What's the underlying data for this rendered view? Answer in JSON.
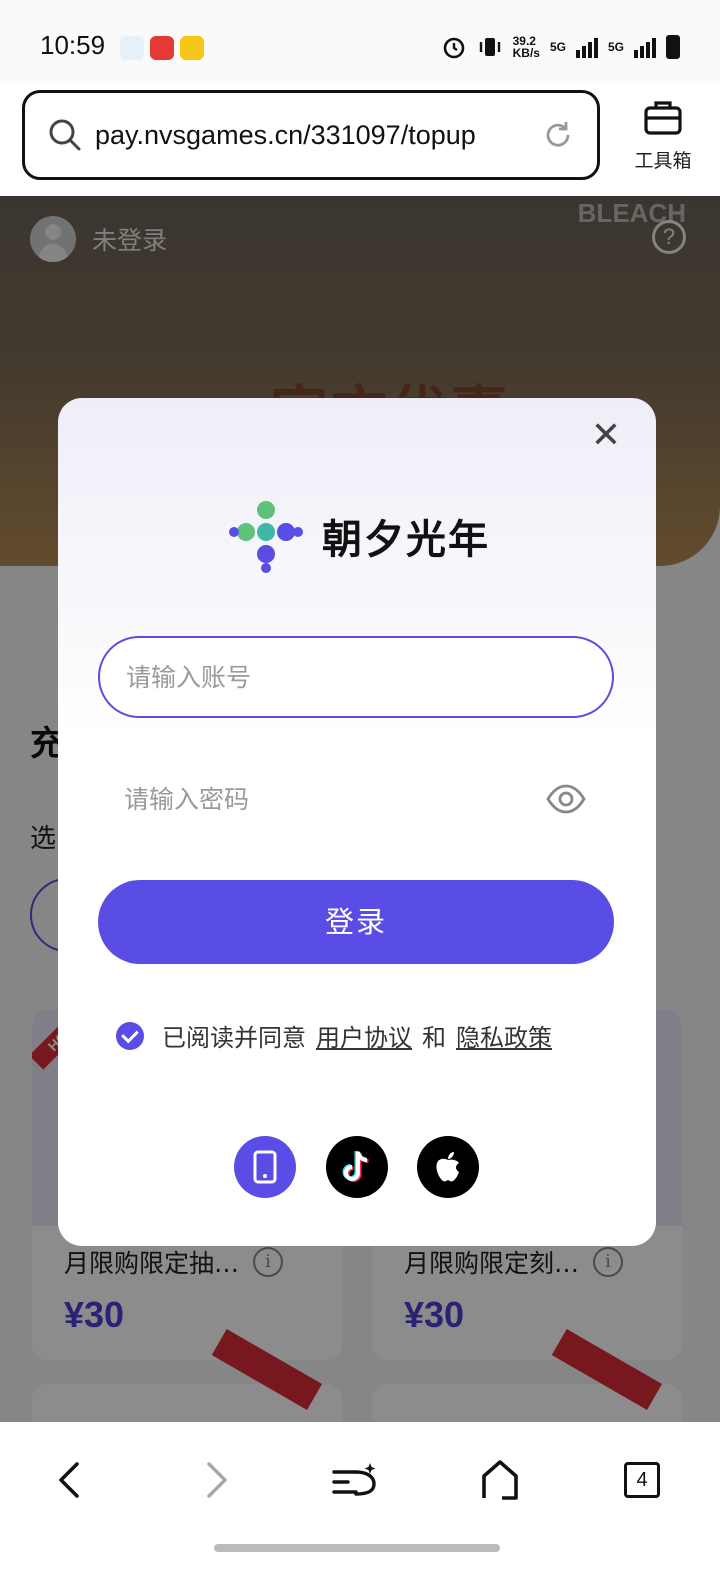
{
  "status_bar": {
    "time": "10:59",
    "network_speed_value": "39.2",
    "network_speed_unit": "KB/s",
    "sim1_label": "5G",
    "sim2_label": "5G"
  },
  "browser": {
    "url": "pay.nvsgames.cn/331097/topup",
    "toolbox_label": "工具箱",
    "tab_count": "4"
  },
  "page": {
    "user_status": "未登录",
    "help_symbol": "?",
    "brand_logo": "BLEACH",
    "banner_text": "官方优惠",
    "section_title_partial": "充",
    "section_subtitle_partial": "选",
    "products": [
      {
        "title": "月限购限定抽…",
        "price": "¥30",
        "badge": "HOT"
      },
      {
        "title": "月限购限定刻…",
        "price": "¥30"
      }
    ]
  },
  "login_modal": {
    "brand_name": "朝夕光年",
    "account_placeholder": "请输入账号",
    "password_placeholder": "请输入密码",
    "login_button": "登录",
    "agree_prefix": "已阅读并同意",
    "user_agreement": "用户协议",
    "and": "和",
    "privacy_policy": "隐私政策",
    "alt_login": [
      "phone-icon",
      "tiktok-icon",
      "apple-icon"
    ]
  },
  "colors": {
    "accent": "#5a4de6",
    "price": "#4b3fd6",
    "hot_badge": "#d92d3a"
  }
}
